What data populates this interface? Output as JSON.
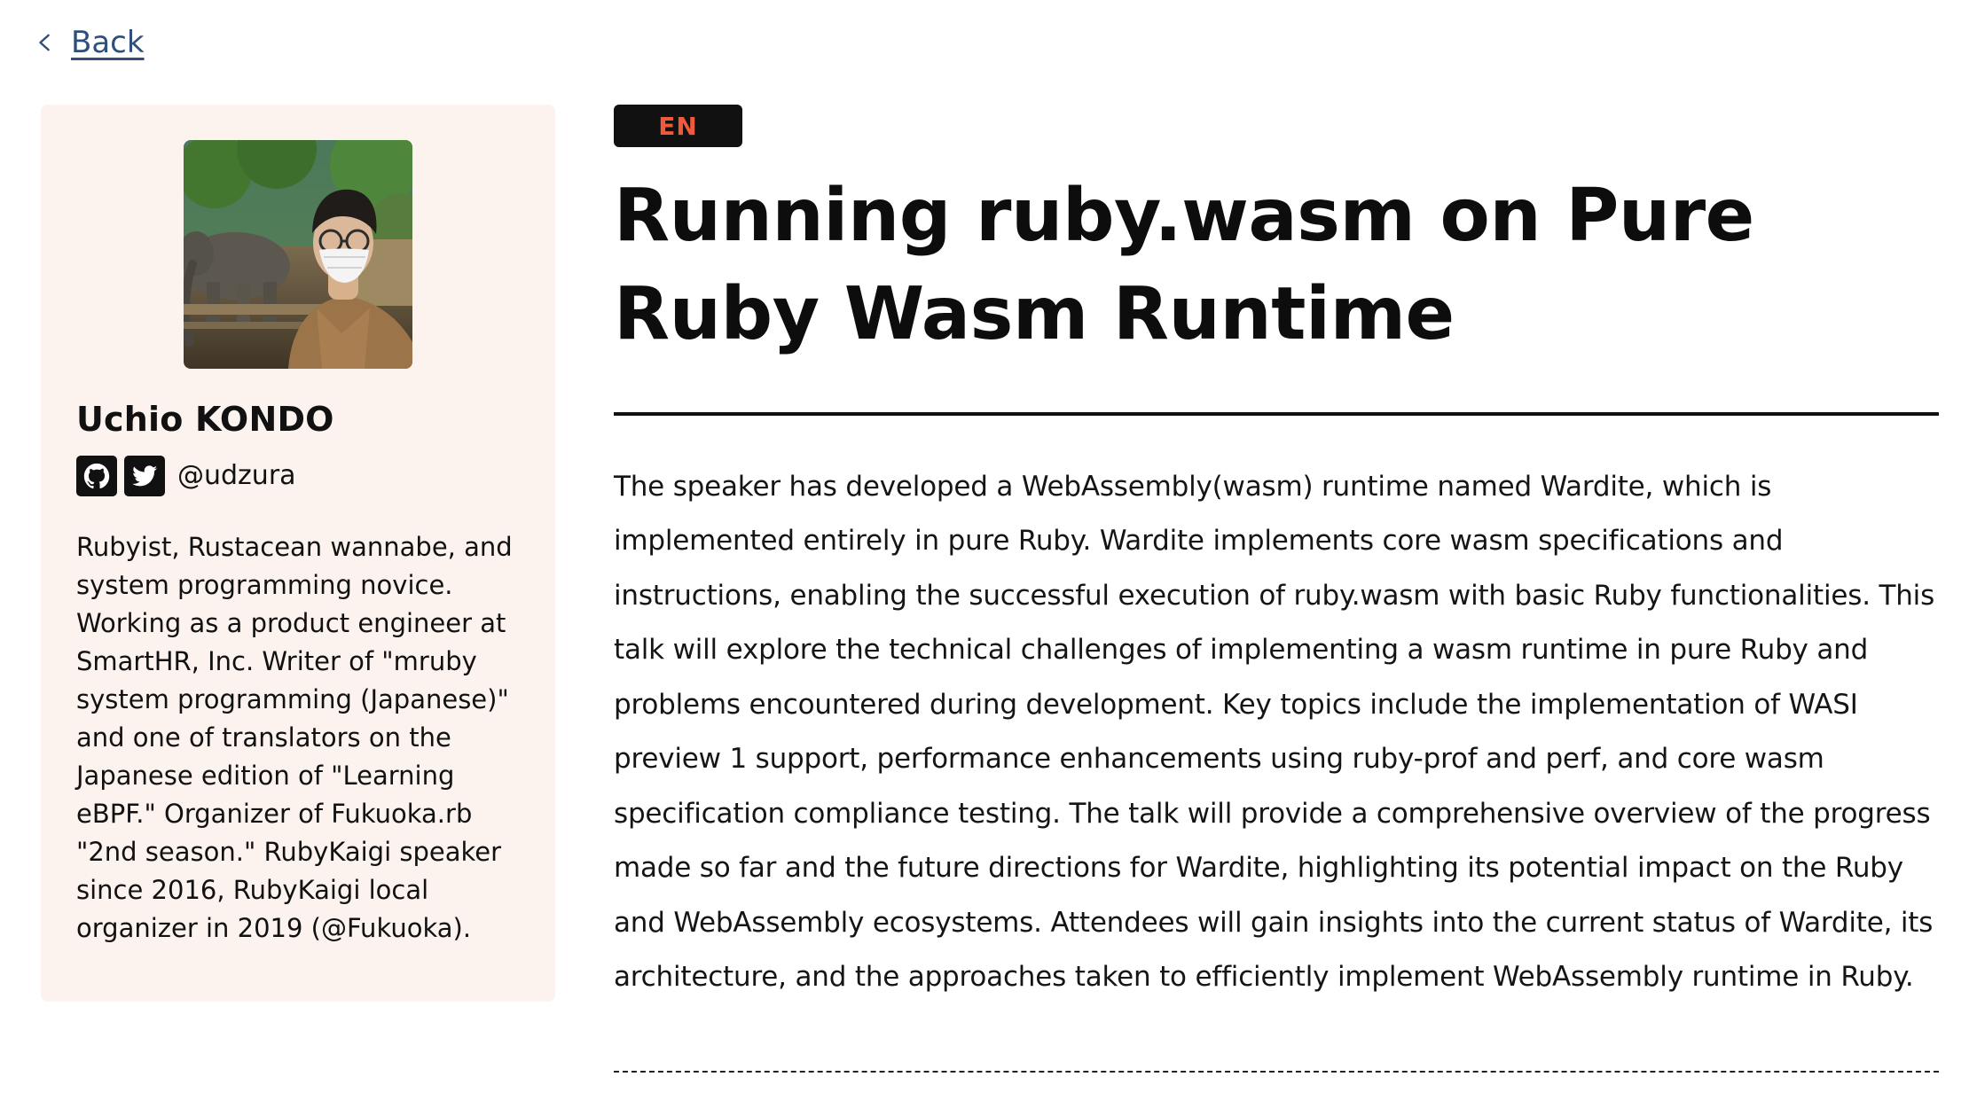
{
  "navigation": {
    "back_label": "Back"
  },
  "speaker": {
    "name": "Uchio KONDO",
    "handle": "@udzura",
    "social_icons": [
      "github-icon",
      "twitter-icon"
    ],
    "bio": "Rubyist, Rustacean wannabe, and system programming novice. Working as a product engineer at SmartHR, Inc. Writer of \"mruby system programming (Japanese)\" and one of translators on the Japanese edition of \"Learning eBPF.\" Organizer of Fukuoka.rb \"2nd season.\" RubyKaigi speaker since 2016, RubyKaigi local organizer in 2019 (@Fukuoka)."
  },
  "talk": {
    "language_badge": "EN",
    "title": "Running ruby.wasm on Pure Ruby Wasm Runtime",
    "abstract": "The speaker has developed a WebAssembly(wasm) runtime named Wardite, which is implemented entirely in pure Ruby. Wardite implements core wasm specifications and instructions, enabling the successful execution of ruby.wasm with basic Ruby functionalities. This talk will explore the technical challenges of implementing a wasm runtime in pure Ruby and problems encountered during development. Key topics include the implementation of WASI preview 1 support, performance enhancements using ruby-prof and perf, and core wasm specification compliance testing. The talk will provide a comprehensive overview of the progress made so far and the future directions for Wardite, highlighting its potential impact on the Ruby and WebAssembly ecosystems. Attendees will gain insights into the current status of Wardite, its architecture, and the approaches taken to efficiently implement WebAssembly runtime in Ruby."
  },
  "colors": {
    "card_background": "#fcf3ef",
    "badge_background": "#111111",
    "badge_text": "#f05a3a",
    "link": "#2f4f7a"
  }
}
